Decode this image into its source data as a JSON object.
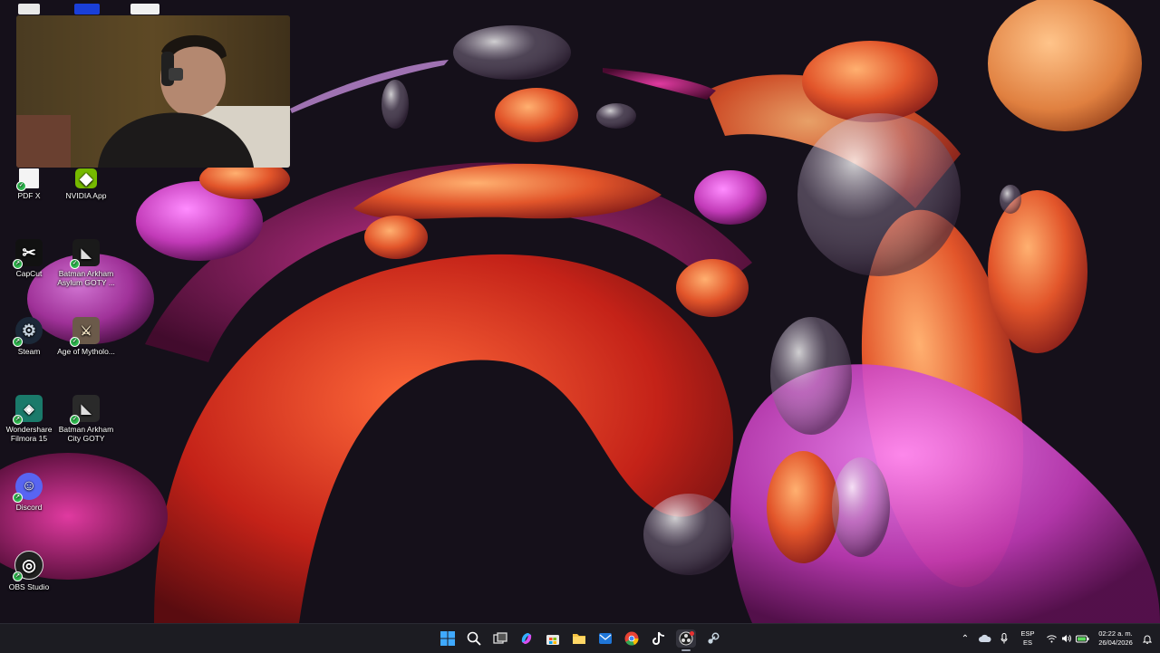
{
  "desktop": {
    "icons": [
      {
        "key": "pdfx",
        "label": "PDF X",
        "glyph": "",
        "color": "#ffffff"
      },
      {
        "key": "nvidia",
        "label": "NVIDIA App",
        "glyph": "◆",
        "color": "#76b900"
      },
      {
        "key": "capcut",
        "label": "CapCut",
        "glyph": "✂",
        "color": "#111111"
      },
      {
        "key": "batman-asylum",
        "label": "Batman Arkham Asylum GOTY ...",
        "glyph": "🦇",
        "color": "#1a1a1a"
      },
      {
        "key": "steam",
        "label": "Steam",
        "glyph": "⚙",
        "color": "#1b2838"
      },
      {
        "key": "age-myth",
        "label": "Age of Mytholo...",
        "glyph": "⚔",
        "color": "#6b5a4a"
      },
      {
        "key": "filmora",
        "label": "Wondershare Filmora 15",
        "glyph": "◈",
        "color": "#1a7a6a"
      },
      {
        "key": "batman-city",
        "label": "Batman Arkham City GOTY",
        "glyph": "🦇",
        "color": "#2a2a2a"
      },
      {
        "key": "discord",
        "label": "Discord",
        "glyph": "☺",
        "color": "#5865f2"
      },
      {
        "key": "obs",
        "label": "OBS Studio",
        "glyph": "◎",
        "color": "#202020"
      }
    ]
  },
  "taskbar": {
    "apps": [
      {
        "key": "start",
        "icon": "windows-icon",
        "glyph": "⊞",
        "color": "#3fa0ff"
      },
      {
        "key": "search",
        "icon": "search-icon",
        "glyph": "⌕",
        "color": "#ffffff"
      },
      {
        "key": "task-view",
        "icon": "task-view-icon",
        "glyph": "❐",
        "color": "#dddddd"
      },
      {
        "key": "copilot",
        "icon": "copilot-icon",
        "glyph": "✦",
        "color": "#c86bff"
      },
      {
        "key": "store",
        "icon": "store-icon",
        "glyph": "▦",
        "color": "#ffffff"
      },
      {
        "key": "explorer",
        "icon": "folder-icon",
        "glyph": "▬",
        "color": "#f5c242"
      },
      {
        "key": "outlook",
        "icon": "mail-icon",
        "glyph": "✉",
        "color": "#2a8cff"
      },
      {
        "key": "chrome",
        "icon": "chrome-icon",
        "glyph": "◉",
        "color": "#e84335"
      },
      {
        "key": "tiktok",
        "icon": "tiktok-icon",
        "glyph": "♪",
        "color": "#ffffff"
      },
      {
        "key": "obs",
        "icon": "obs-icon",
        "glyph": "◎",
        "color": "#dddddd"
      },
      {
        "key": "steam",
        "icon": "steam-icon",
        "glyph": "⚙",
        "color": "#c7d5e0"
      }
    ],
    "tray": {
      "language_top": "ESP",
      "language_bottom": "ES",
      "time": "02:22 a. m.",
      "date": "26/04/2026"
    }
  }
}
